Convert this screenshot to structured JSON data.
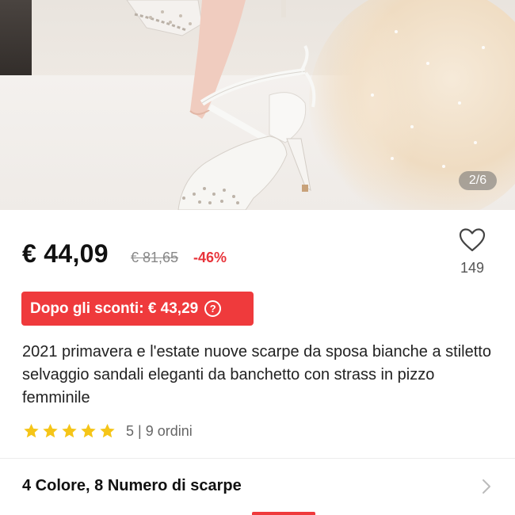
{
  "gallery": {
    "counter": "2/6"
  },
  "pricing": {
    "price": "€ 44,09",
    "old_price": "€ 81,65",
    "discount": "-46%"
  },
  "wishlist": {
    "icon": "heart-icon",
    "count": "149"
  },
  "coupon": {
    "label": "Dopo gli sconti: € 43,29",
    "info_icon": "?",
    "color": "#ef3a3c"
  },
  "product": {
    "title": "2021 primavera e l'estate nuove scarpe da sposa bianche a stiletto selvaggio sandali eleganti da banchetto con strass in pizzo femminile"
  },
  "rating": {
    "stars": 5,
    "score": "5",
    "orders": "9 ordini",
    "star_color": "#f5c518"
  },
  "variants": {
    "label": "4 Colore, 8 Numero di scarpe"
  }
}
